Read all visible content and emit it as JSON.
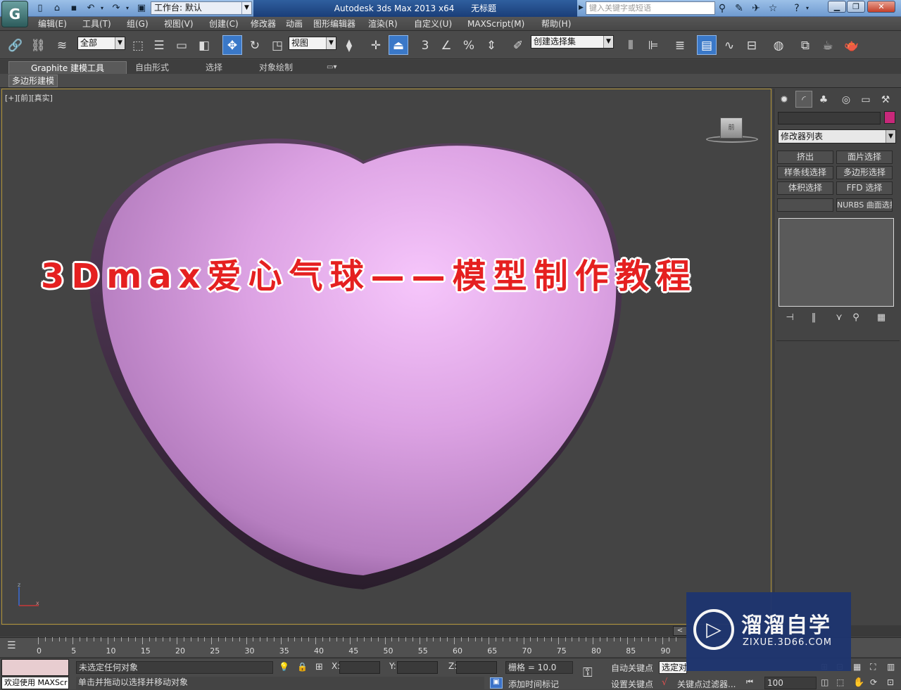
{
  "titlebar": {
    "app_icon": "3ds-max-logo",
    "workspace_label": "工作台: 默认",
    "app_name": "Autodesk 3ds Max  2013 x64",
    "doc_name": "无标题",
    "search_placeholder": "键入关键字或短语"
  },
  "menu": [
    "编辑(E)",
    "工具(T)",
    "组(G)",
    "视图(V)",
    "创建(C)",
    "修改器",
    "动画",
    "图形编辑器",
    "渲染(R)",
    "自定义(U)",
    "MAXScript(M)",
    "帮助(H)"
  ],
  "toolbar": {
    "selection_filter": "全部",
    "reference_coord": "视图",
    "named_selection": "创建选择集",
    "snap_label": "3"
  },
  "ribbon": {
    "tabs": [
      "Graphite 建模工具",
      "自由形式",
      "选择",
      "对象绘制"
    ],
    "active_tab": "Graphite 建模工具",
    "subtab": "多边形建模"
  },
  "viewport": {
    "label": "[+][前][真实]",
    "object_color": "#e6a8ec",
    "viewcube_label": "前"
  },
  "overlay_title": "3Dmax爱心气球——模型制作教程",
  "command_panel": {
    "modifier_list": "修改器列表",
    "object_color": "#c8287a",
    "buttons": [
      "挤出",
      "面片选择",
      "样条线选择",
      "多边形选择",
      "体积选择",
      "FFD 选择",
      "",
      "NURBS 曲面选择"
    ]
  },
  "timeline": {
    "ticks": [
      "0",
      "5",
      "10",
      "15",
      "20",
      "25",
      "30",
      "35",
      "40",
      "45",
      "50",
      "55",
      "60",
      "65",
      "70",
      "75",
      "80",
      "85",
      "90"
    ],
    "slider_label": "<"
  },
  "status": {
    "welcome": "欢迎使用 MAXScr",
    "selection_status": "未选定任何对象",
    "prompt": "单击并拖动以选择并移动对象",
    "x_label": "X:",
    "y_label": "Y:",
    "z_label": "Z:",
    "grid": "栅格 = 10.0",
    "add_time_tag": "添加时间标记",
    "auto_key": "自动关键点",
    "set_key": "设置关键点",
    "selected_dropdown": "选定对",
    "key_filters": "关键点过滤器...",
    "frame": "100"
  },
  "watermark": {
    "title": "溜溜自学",
    "url": "ZIXUE.3D66.COM"
  }
}
